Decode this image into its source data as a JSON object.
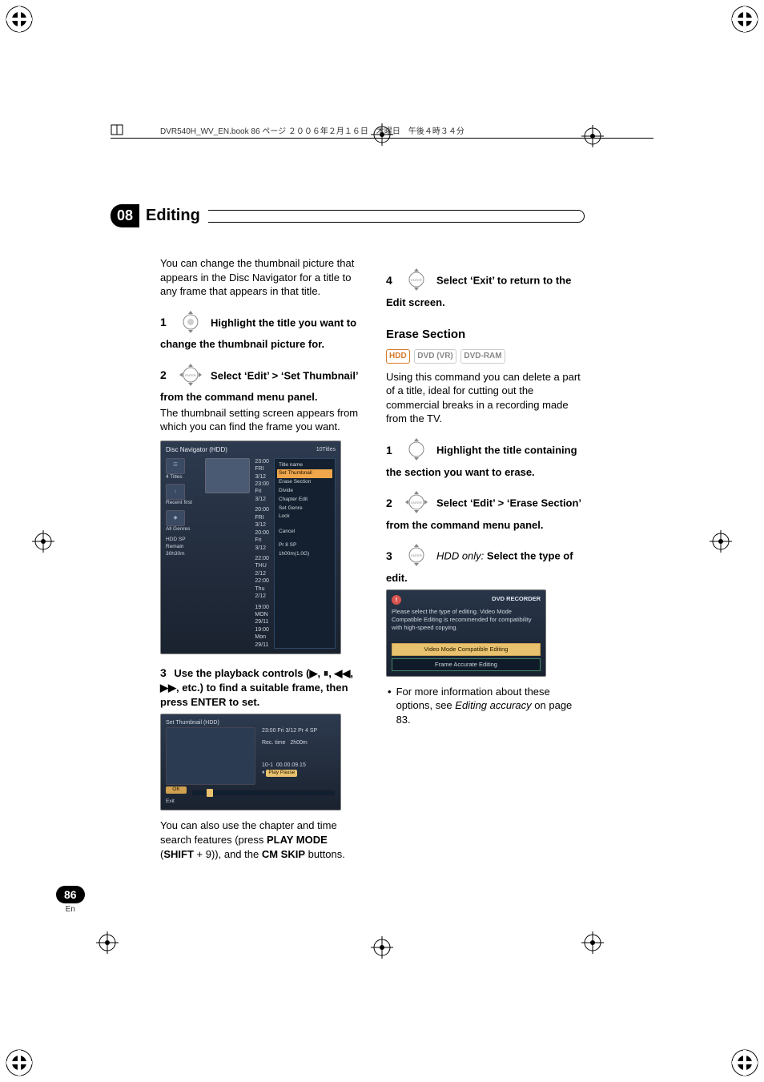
{
  "book_line": "DVR540H_WV_EN.book 86 ページ ２００６年２月１６日　木曜日　午後４時３４分",
  "chapter": {
    "num": "08",
    "title": "Editing"
  },
  "left": {
    "intro": "You can change the thumbnail picture that appears in the Disc Navigator for a title to any frame that appears in that title.",
    "step1_text": "Highlight the title you want to change the thumbnail picture for.",
    "step2_text": "Select ‘Edit’ > ‘Set Thumbnail’ from the command menu panel.",
    "step2_after": "The thumbnail setting screen appears from which you can find the frame you want.",
    "step3_pre": "Use the playback controls (",
    "step3_mid": ", etc.) to find a suitable frame, then press ENTER to set.",
    "after_panel2": "You can also use the chapter and time search features (press ",
    "play_mode": "PLAY MODE",
    "shift": "SHIFT",
    "plus9": " + 9",
    "cm_skip": "CM SKIP",
    "after_panel2_tail": " buttons."
  },
  "right": {
    "step4_text": "Select ‘Exit’ to return to the Edit screen.",
    "erase_section_h": "Erase Section",
    "badges": [
      "HDD",
      "DVD (VR)",
      "DVD-RAM"
    ],
    "erase_intro": "Using this command you can delete a part of a title, ideal for cutting out the commercial breaks in a recording made from the TV.",
    "step1_text": "Highlight the title containing the section you want to erase.",
    "step2_text": "Select ‘Edit’ > ‘Erase Section’ from the command menu panel.",
    "step3_pre": "HDD only:",
    "step3_text": " Select the type of edit.",
    "bullet": "For more information about these options, see ",
    "bullet_em": "Editing accuracy",
    "bullet_tail": " on page 83."
  },
  "disc_nav": {
    "title": "Disc Navigator (HDD)",
    "count": "10Titles",
    "side": [
      "4 Titles",
      "Recent first",
      "All Genres",
      "HDD SP",
      "Remain 30h30m"
    ],
    "rows": [
      {
        "t1": "23:00 FRI 3/12",
        "t2": "23:00 Fri 3/12"
      },
      {
        "t1": "20:00 FRI 3/12",
        "t2": "20:00 Fri 3/12"
      },
      {
        "t1": "22:00 THU 2/12",
        "t2": "22:00 Thu 2/12"
      },
      {
        "t1": "19:00 MON 29/11",
        "t2": "19:00 Mon 29/11"
      }
    ],
    "menu": [
      "Title name",
      "Set Thumbnail",
      "Erase Section",
      "Divide",
      "Chapter Edit",
      "Set Genre",
      "Lock",
      "Cancel"
    ],
    "menu_sel": 1,
    "foot": [
      "Pr 8  SP",
      "1h00m(1.0G)"
    ]
  },
  "set_thumb": {
    "title": "Set Thumbnail (HDD)",
    "meta1": "23:00 Fri 3/12 Pr 4   SP",
    "meta2_a": "Rec. time",
    "meta2_b": "2h00m",
    "meta3_a": "10-1",
    "meta3_b": "00.00.09.15",
    "chip": "Play Pause",
    "ok": "OK",
    "exit": "Exit"
  },
  "dialog": {
    "hdr": "DVD RECORDER",
    "msg": "Please select the type of editing. Video Mode Compatible Editing is recommended for compatibility with high-speed copying.",
    "btn1": "Video Mode Compatible Editing",
    "btn2": "Frame Accurate Editing"
  },
  "step_labels": {
    "s1": "1",
    "s2": "2",
    "s3": "3",
    "s4": "4"
  },
  "page_footer": {
    "num": "86",
    "lang": "En"
  }
}
